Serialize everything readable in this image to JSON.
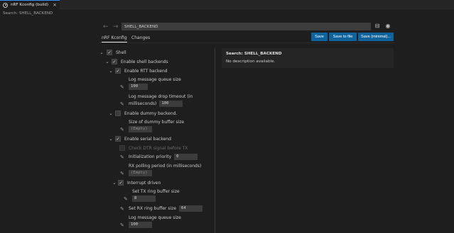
{
  "tab": {
    "title": "nRF Kconfig (build)",
    "close": "×"
  },
  "search_status": "Search: SHELL_BACKEND",
  "toolbar": {
    "back": "←",
    "forward": "→",
    "search_value": "SHELL_BACKEND",
    "save": "Save",
    "save_to_file": "Save to file",
    "save_minimal": "Save (minimal)..."
  },
  "subtabs": [
    "nRF Kconfig",
    "Changes"
  ],
  "tree": {
    "shell": "Shell",
    "enable_shell_backends": "Enable shell backends",
    "enable_rtt_backend": "Enable RTT backend",
    "rtt_log_queue_size": "Log message queue size",
    "rtt_log_queue_value": "100",
    "rtt_drop_timeout_line1": "Log message drop timeout (in",
    "rtt_drop_timeout_line2": "milliseconds)",
    "rtt_drop_timeout_value": "100",
    "enable_dummy_backend": "Enable dummy backend.",
    "dummy_buffer_size": "Size of dummy buffer size",
    "dummy_buffer_value": "(Empty)",
    "enable_serial_backend": "Enable serial backend",
    "check_dtr": "Check DTR signal before TX",
    "init_priority": "Initialization priority",
    "init_priority_value": "0",
    "rx_polling_period": "RX polling period (in milliseconds)",
    "rx_polling_value": "(Empty)",
    "interrupt_driven": "Interrupt driven",
    "tx_ring_buffer": "Set TX ring buffer size",
    "tx_ring_value": "8",
    "rx_ring_buffer": "Set RX ring buffer size",
    "rx_ring_value": "64",
    "serial_log_queue_size": "Log message queue size",
    "serial_log_queue_value": "100"
  },
  "details": {
    "title": "Search: SHELL_BACKEND",
    "body": "No description available."
  },
  "colors": {
    "accent": "#0e639c",
    "background": "#1e1e1e",
    "panel": "#252526"
  }
}
